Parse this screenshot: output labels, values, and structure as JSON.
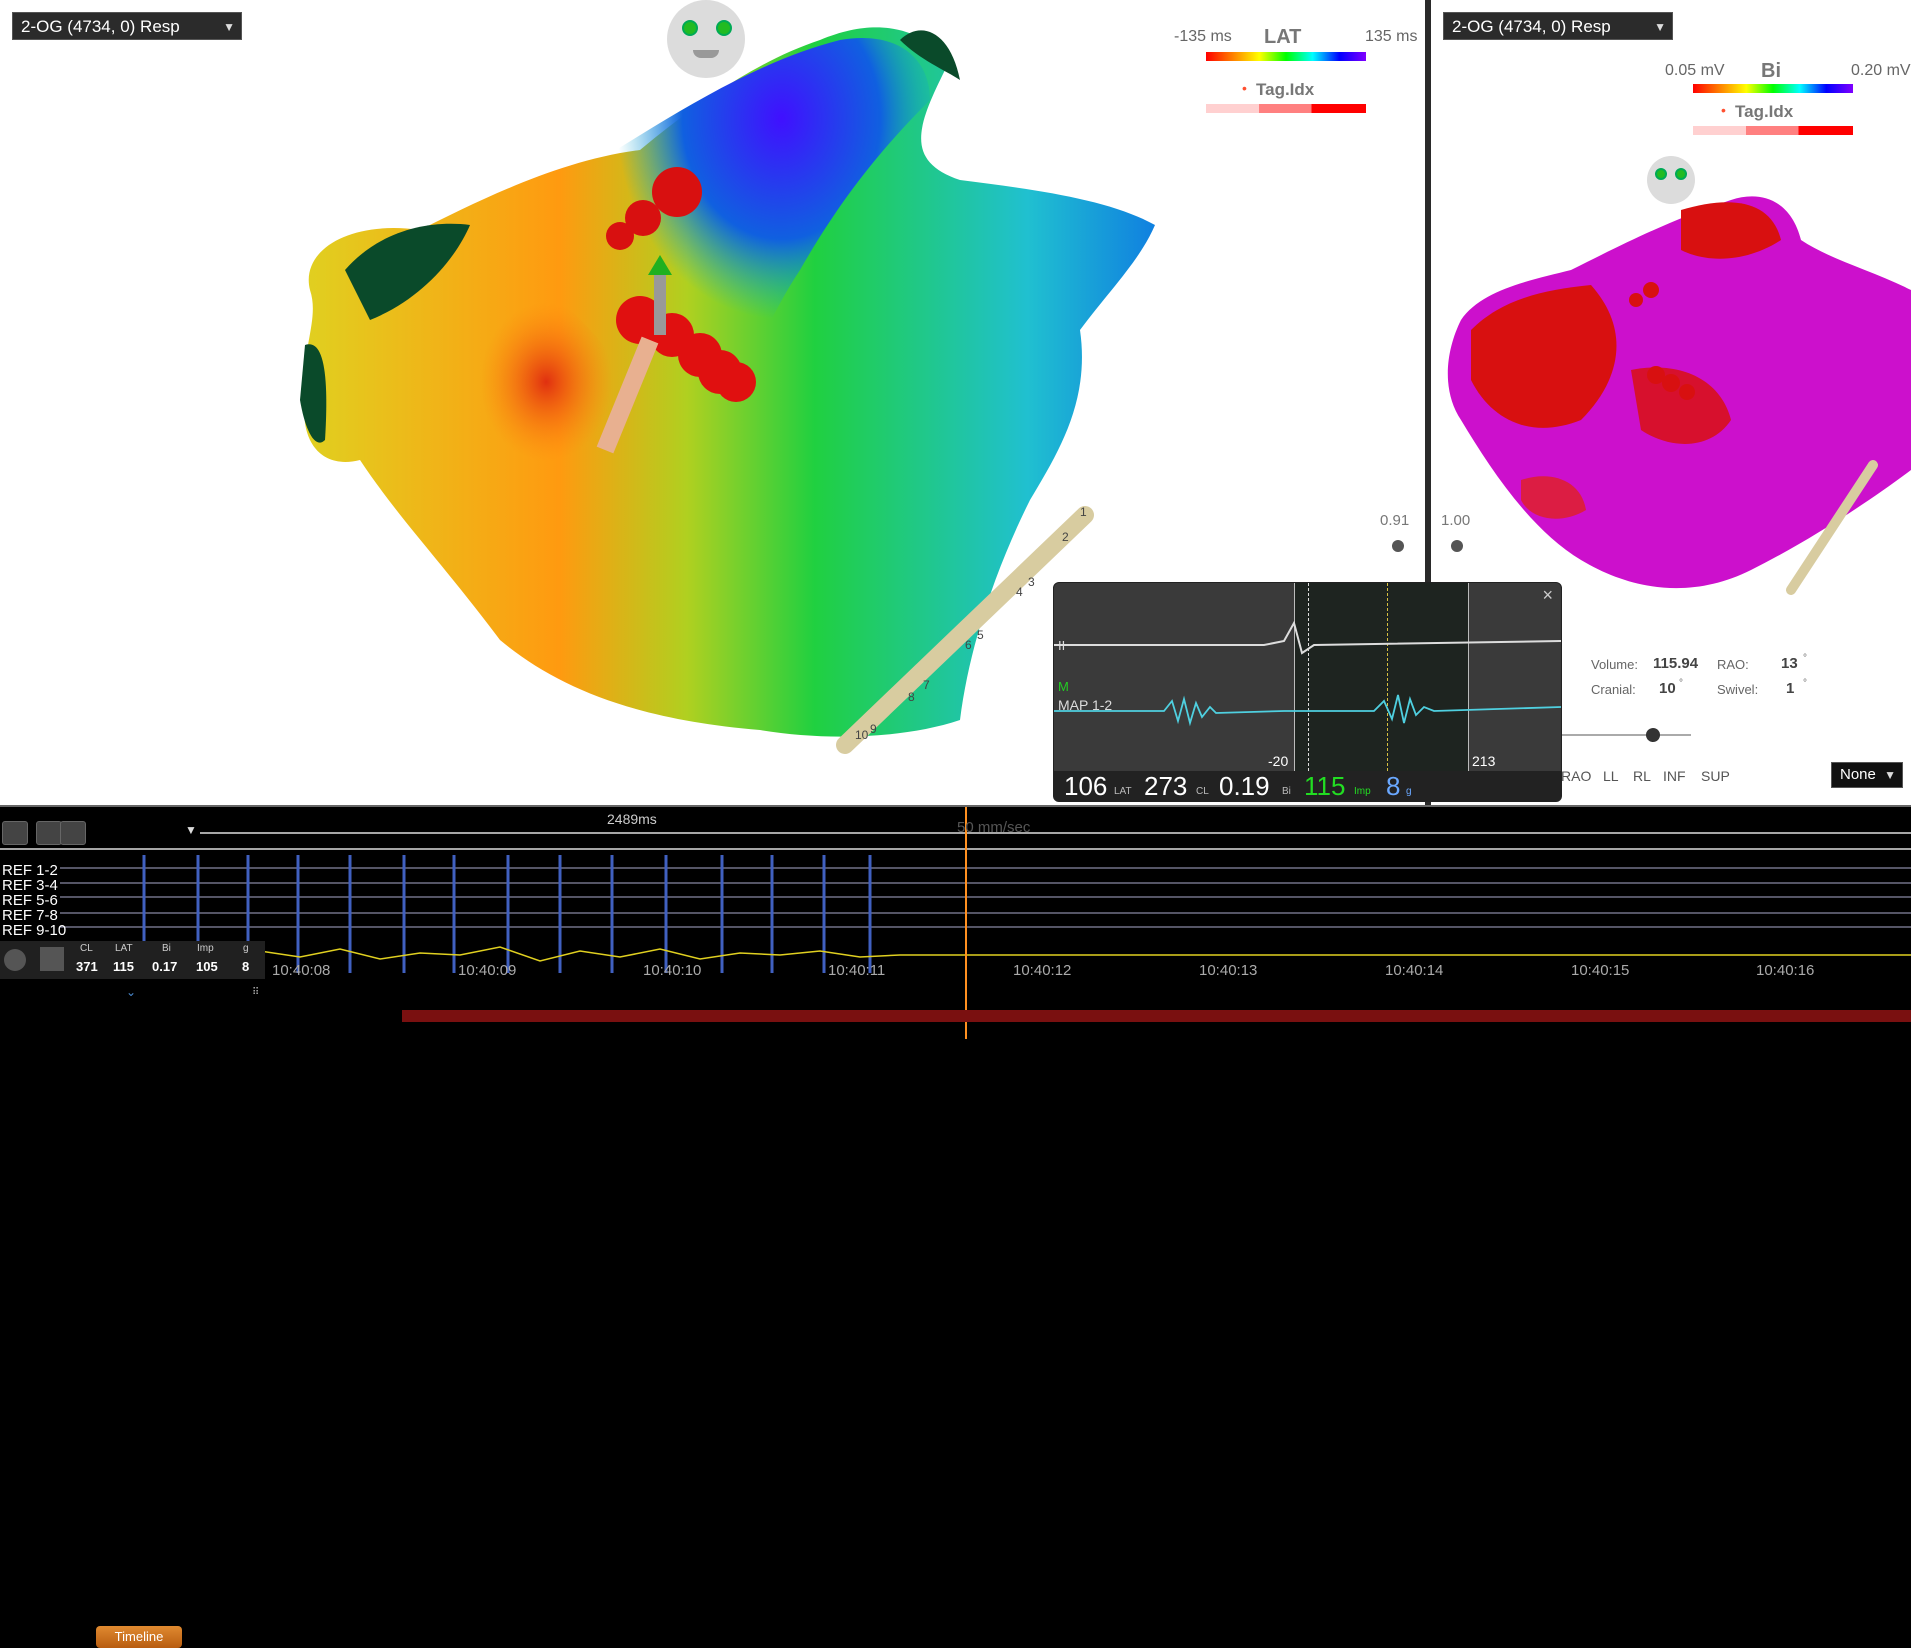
{
  "left_map": {
    "dropdown": "2-OG (4734, 0) Resp",
    "legend": {
      "min": "-135 ms",
      "title": "LAT",
      "max": "135 ms",
      "tag_label": "Tag.Idx"
    },
    "slider_value": "0.91"
  },
  "right_map": {
    "dropdown": "2-OG (4734, 0) Resp",
    "legend": {
      "min": "0.05 mV",
      "title": "Bi",
      "max": "0.20 mV",
      "tag_label": "Tag.Idx"
    },
    "slider_value": "1.00",
    "stats": {
      "volume_label": "Volume:",
      "volume_value": "115.94",
      "rao_label": "RAO:",
      "rao_value": "13",
      "cranial_label": "Cranial:",
      "cranial_value": "10",
      "swivel_label": "Swivel:",
      "swivel_value": "1",
      "degree": "°"
    },
    "view_buttons": [
      "RAO",
      "LL",
      "RL",
      "INF",
      "SUP"
    ],
    "view_select": "None"
  },
  "egm_popup": {
    "trace1_label": "II",
    "trace2_marker": "M",
    "trace2_label": "MAP 1-2",
    "left_marker": "-20",
    "right_marker": "213",
    "readout": {
      "lat_value": "106",
      "lat_unit": "LAT",
      "cl_value": "273",
      "cl_unit": "CL",
      "bi_value": "0.19",
      "bi_unit": "Bi",
      "imp_value": "115",
      "imp_unit": "Imp",
      "g_value": "8",
      "g_unit": "g"
    }
  },
  "timeline": {
    "button_label": "Timeline",
    "interval_label": "2489ms",
    "speed_label": "50 mm/sec",
    "channels": [
      "REF 1-2",
      "REF 3-4",
      "REF 5-6",
      "REF 7-8",
      "REF 9-10"
    ],
    "stats": {
      "labels": [
        "CL",
        "LAT",
        "Bi",
        "Imp",
        "g"
      ],
      "values": [
        "371",
        "115",
        "0.17",
        "105",
        "8"
      ]
    },
    "times": [
      "10:40:08",
      "10:40:09",
      "10:40:10",
      "10:40:11",
      "10:40:12",
      "10:40:13",
      "10:40:14",
      "10:40:15",
      "10:40:16"
    ]
  },
  "catheter_labels": [
    "1",
    "2",
    "3",
    "4",
    "5",
    "6",
    "7",
    "8",
    "9",
    "10"
  ],
  "colors": {
    "bar_orange": "#e08a30",
    "trace_cyan": "#4fd0e0",
    "trace_yellow": "#e0d020",
    "cursor_orange": "#ff9020",
    "readout_green": "#22dd22",
    "readout_blue": "#6aa8ff"
  }
}
